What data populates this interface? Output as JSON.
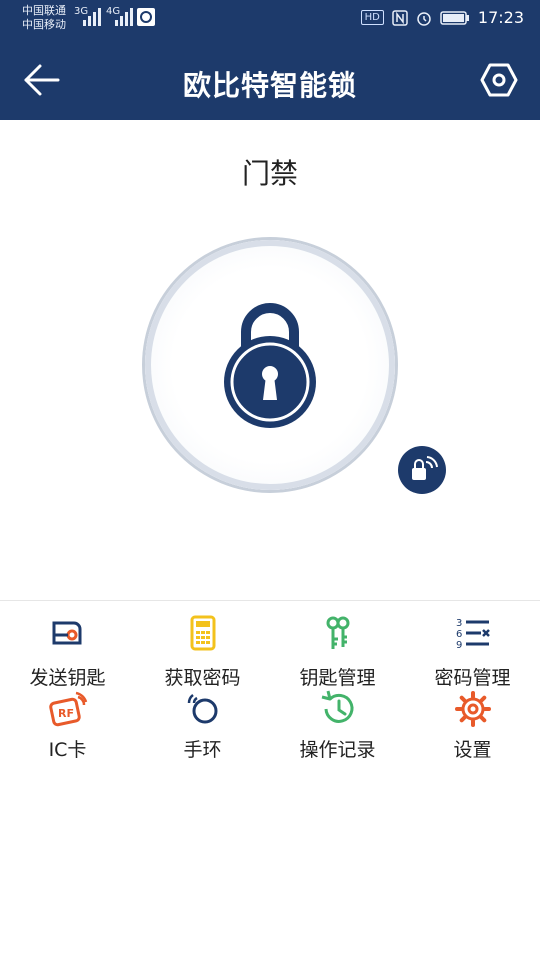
{
  "status_bar": {
    "carrier1": "中国联通",
    "carrier2": "中国移动",
    "net1": "3G",
    "net2": "4G",
    "hd": "HD",
    "time": "17:23"
  },
  "topbar": {
    "title": "欧比特智能锁"
  },
  "main": {
    "door_label": "门禁"
  },
  "menu": [
    {
      "label": "发送钥匙",
      "icon": "send-key-icon"
    },
    {
      "label": "获取密码",
      "icon": "get-password-icon"
    },
    {
      "label": "钥匙管理",
      "icon": "key-management-icon"
    },
    {
      "label": "密码管理",
      "icon": "password-management-icon"
    },
    {
      "label": "IC卡",
      "icon": "ic-card-icon"
    },
    {
      "label": "手环",
      "icon": "bracelet-icon"
    },
    {
      "label": "操作记录",
      "icon": "operation-log-icon"
    },
    {
      "label": "设置",
      "icon": "settings-icon"
    }
  ],
  "colors": {
    "header": "#1d3a6b",
    "accent_orange": "#e85a2a",
    "accent_yellow": "#f3c21c",
    "accent_green": "#43b36a",
    "icon_navy": "#1d3a6b"
  }
}
